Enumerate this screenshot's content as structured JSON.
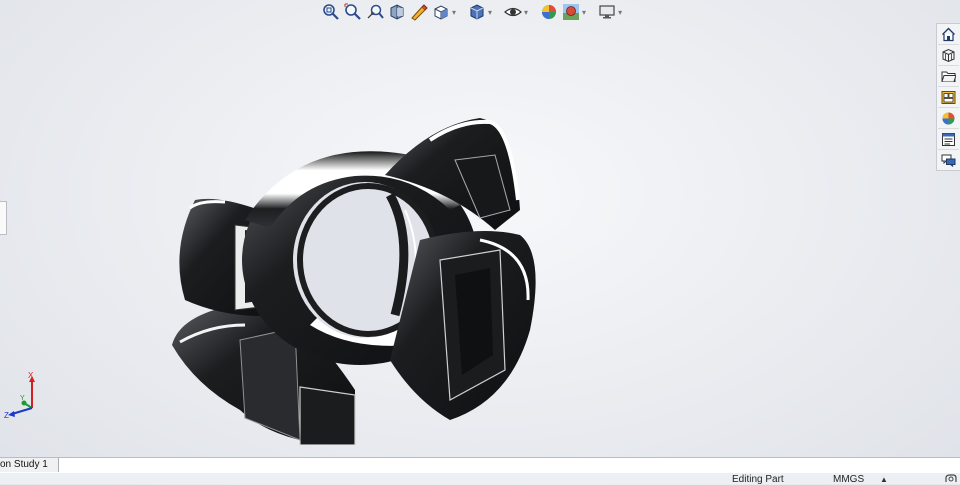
{
  "heads_up_toolbar": {
    "tools": [
      {
        "name": "zoom-to-fit"
      },
      {
        "name": "zoom-to-area"
      },
      {
        "name": "previous-view"
      },
      {
        "name": "section-view"
      },
      {
        "name": "dynamic-annotation-views"
      },
      {
        "name": "view-orientation",
        "dropdown": true
      },
      {
        "name": "display-style",
        "dropdown": true
      },
      {
        "name": "hide-show-items",
        "dropdown": true
      },
      {
        "name": "edit-appearance"
      },
      {
        "name": "apply-scene",
        "dropdown": true
      },
      {
        "name": "view-settings",
        "dropdown": true
      }
    ]
  },
  "task_pane": {
    "items": [
      "home",
      "parts-library",
      "file-explorer",
      "view-palette",
      "appearances",
      "custom-properties",
      "forum"
    ]
  },
  "triad": {
    "x_label": "X",
    "y_label": "Y",
    "z_label": "Z"
  },
  "bottom_tabs": {
    "active_label": "on Study 1"
  },
  "status_bar": {
    "mode": "Editing Part",
    "units": "MMGS",
    "units_caret": "▲"
  },
  "colors": {
    "background_top": "#f7f8fa",
    "background_bottom": "#dfe2e8",
    "model_body": "#1c1d1f",
    "model_highlight": "#ffffff",
    "axis_x": "#d21f1f",
    "axis_y": "#1a9d2a",
    "axis_z": "#1d38c8"
  }
}
